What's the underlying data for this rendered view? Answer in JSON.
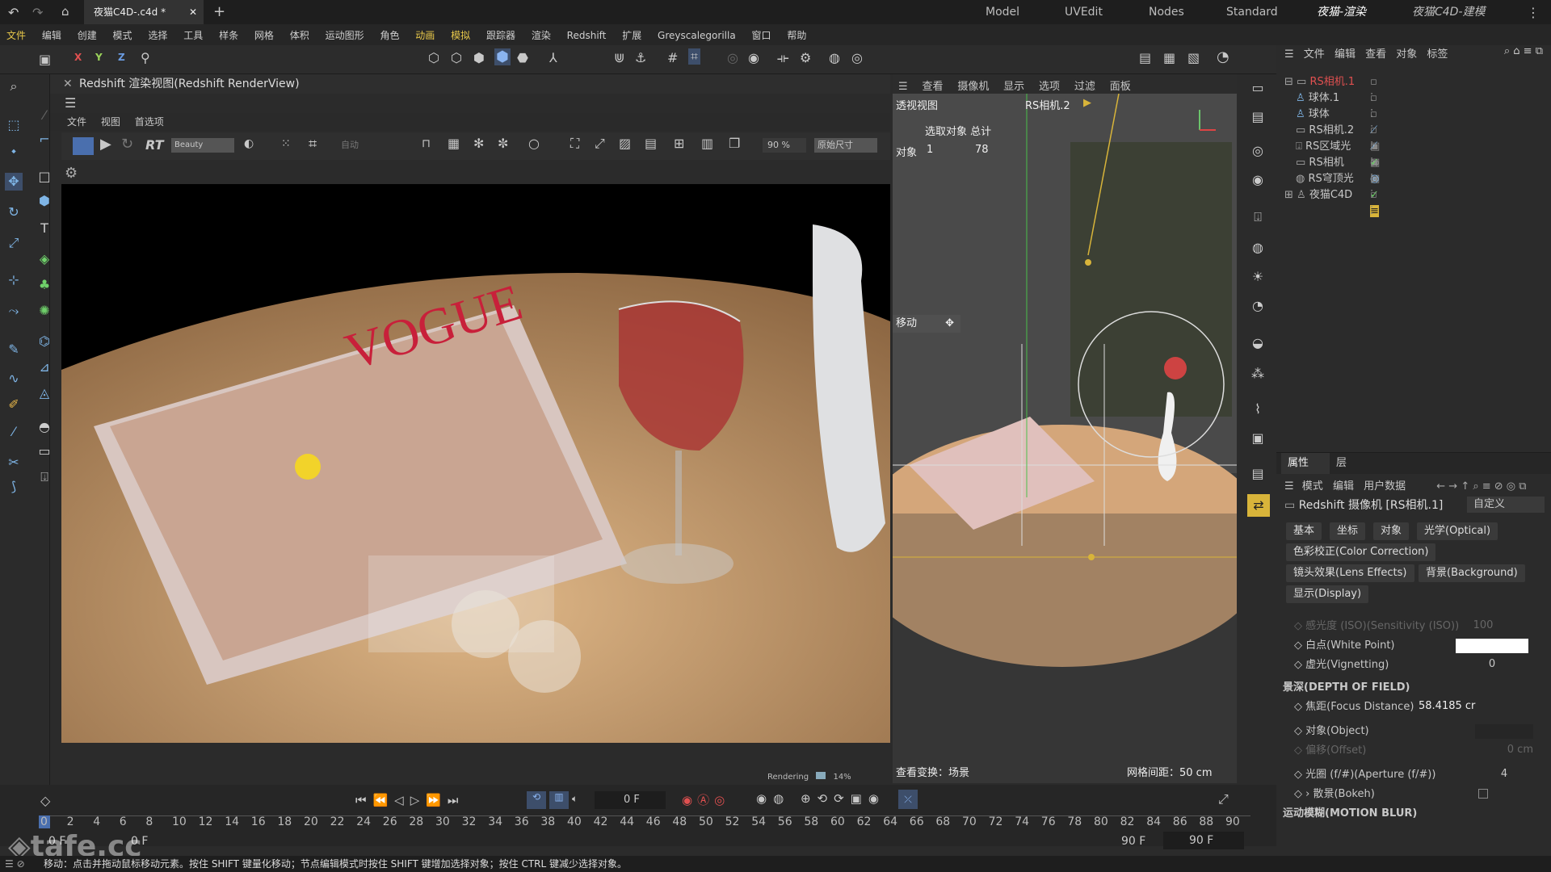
{
  "titlebar": {
    "tab_title": "夜猫C4D-.c4d *",
    "layouts": [
      "Model",
      "UVEdit",
      "Nodes",
      "Standard",
      "夜猫-渲染",
      "夜猫C4D-建模"
    ]
  },
  "menu": [
    "文件",
    "编辑",
    "创建",
    "模式",
    "选择",
    "工具",
    "样条",
    "网格",
    "体积",
    "运动图形",
    "角色",
    "动画",
    "模拟",
    "跟踪器",
    "渲染",
    "Redshift",
    "扩展",
    "Greyscalegorilla",
    "窗口",
    "帮助"
  ],
  "axes": {
    "x": "X",
    "y": "Y",
    "z": "Z"
  },
  "renderview": {
    "title": "Redshift 渲染视图(Redshift RenderView)",
    "menu": [
      "文件",
      "视图",
      "首选项"
    ],
    "aov": "Beauty",
    "auto": "自动",
    "zoom": "90 %",
    "size_mode": "原始尺寸",
    "rt_label": "RT",
    "rendering_label": "Rendering",
    "rendering_pct": "14%"
  },
  "viewport": {
    "menu": [
      "查看",
      "摄像机",
      "显示",
      "选项",
      "过滤",
      "面板"
    ],
    "view_name": "透视视图",
    "camera_name": "RS相机.2",
    "stats_header": "选取对象 总计",
    "stats_label": "对象",
    "stats_selected": "1",
    "stats_total": "78",
    "move_label": "移动",
    "transform_label": "查看变换：场景",
    "grid_label": "网格间距：50 cm"
  },
  "objects": [
    {
      "name": "RS相机.1",
      "color": "#e05050"
    },
    {
      "name": "球体.1",
      "color": "#d0d0d0"
    },
    {
      "name": "球体",
      "color": "#d0d0d0"
    },
    {
      "name": "RS相机.2",
      "color": "#d0d0d0"
    },
    {
      "name": "RS区域光",
      "color": "#d0d0d0"
    },
    {
      "name": "RS相机",
      "color": "#d0d0d0"
    },
    {
      "name": "RS穹顶光",
      "color": "#d0d0d0"
    },
    {
      "name": "夜猫C4D",
      "color": "#d0d0d0"
    }
  ],
  "objmgr_menu": [
    "文件",
    "编辑",
    "查看",
    "对象",
    "标签"
  ],
  "attributes": {
    "tabs": [
      "属性",
      "层"
    ],
    "menu": [
      "模式",
      "编辑",
      "用户数据"
    ],
    "object_title": "Redshift 摄像机 [RS相机.1]",
    "preset": "自定义",
    "subtabs": [
      "基本",
      "坐标",
      "对象",
      "光学(Optical)"
    ],
    "subtabs2": [
      "色彩校正(Color Correction)",
      "镜头效果(Lens Effects)",
      "背景(Background)",
      "显示(Display)"
    ],
    "rows": [
      {
        "label": "感光度 (ISO)(Sensitivity (ISO))",
        "value": "100"
      },
      {
        "label": "白点(White Point)",
        "value": ""
      },
      {
        "label": "虚光(Vignetting)",
        "value": "0"
      },
      {
        "label": "景深(DEPTH OF FIELD)",
        "value": ""
      },
      {
        "label": "焦距(Focus Distance)",
        "value": "58.4185 cr"
      },
      {
        "label": "对象(Object)",
        "value": ""
      },
      {
        "label": "偏移(Offset)",
        "value": "0 cm"
      },
      {
        "label": "光圈 (f/#)(Aperture (f/#))",
        "value": "4"
      },
      {
        "label": "› 散景(Bokeh)",
        "value": ""
      },
      {
        "label": "运动模糊(MOTION BLUR)",
        "value": ""
      }
    ]
  },
  "timeline": {
    "frame": "0 F",
    "start": "0 F",
    "start2": "0 F",
    "end": "90 F",
    "end2": "90 F",
    "ticks": [
      "0",
      "2",
      "4",
      "6",
      "8",
      "10",
      "12",
      "14",
      "16",
      "18",
      "20",
      "22",
      "24",
      "26",
      "28",
      "30",
      "32",
      "34",
      "36",
      "38",
      "40",
      "42",
      "44",
      "46",
      "48",
      "50",
      "52",
      "54",
      "56",
      "58",
      "60",
      "62",
      "64",
      "66",
      "68",
      "70",
      "72",
      "74",
      "76",
      "78",
      "80",
      "82",
      "84",
      "86",
      "88",
      "90"
    ]
  },
  "status": "移动：点击并拖动鼠标移动元素。按住 SHIFT 键量化移动；节点编辑模式时按住 SHIFT 键增加选择对象；按住 CTRL 键减少选择对象。",
  "watermark": "tafe.cc"
}
